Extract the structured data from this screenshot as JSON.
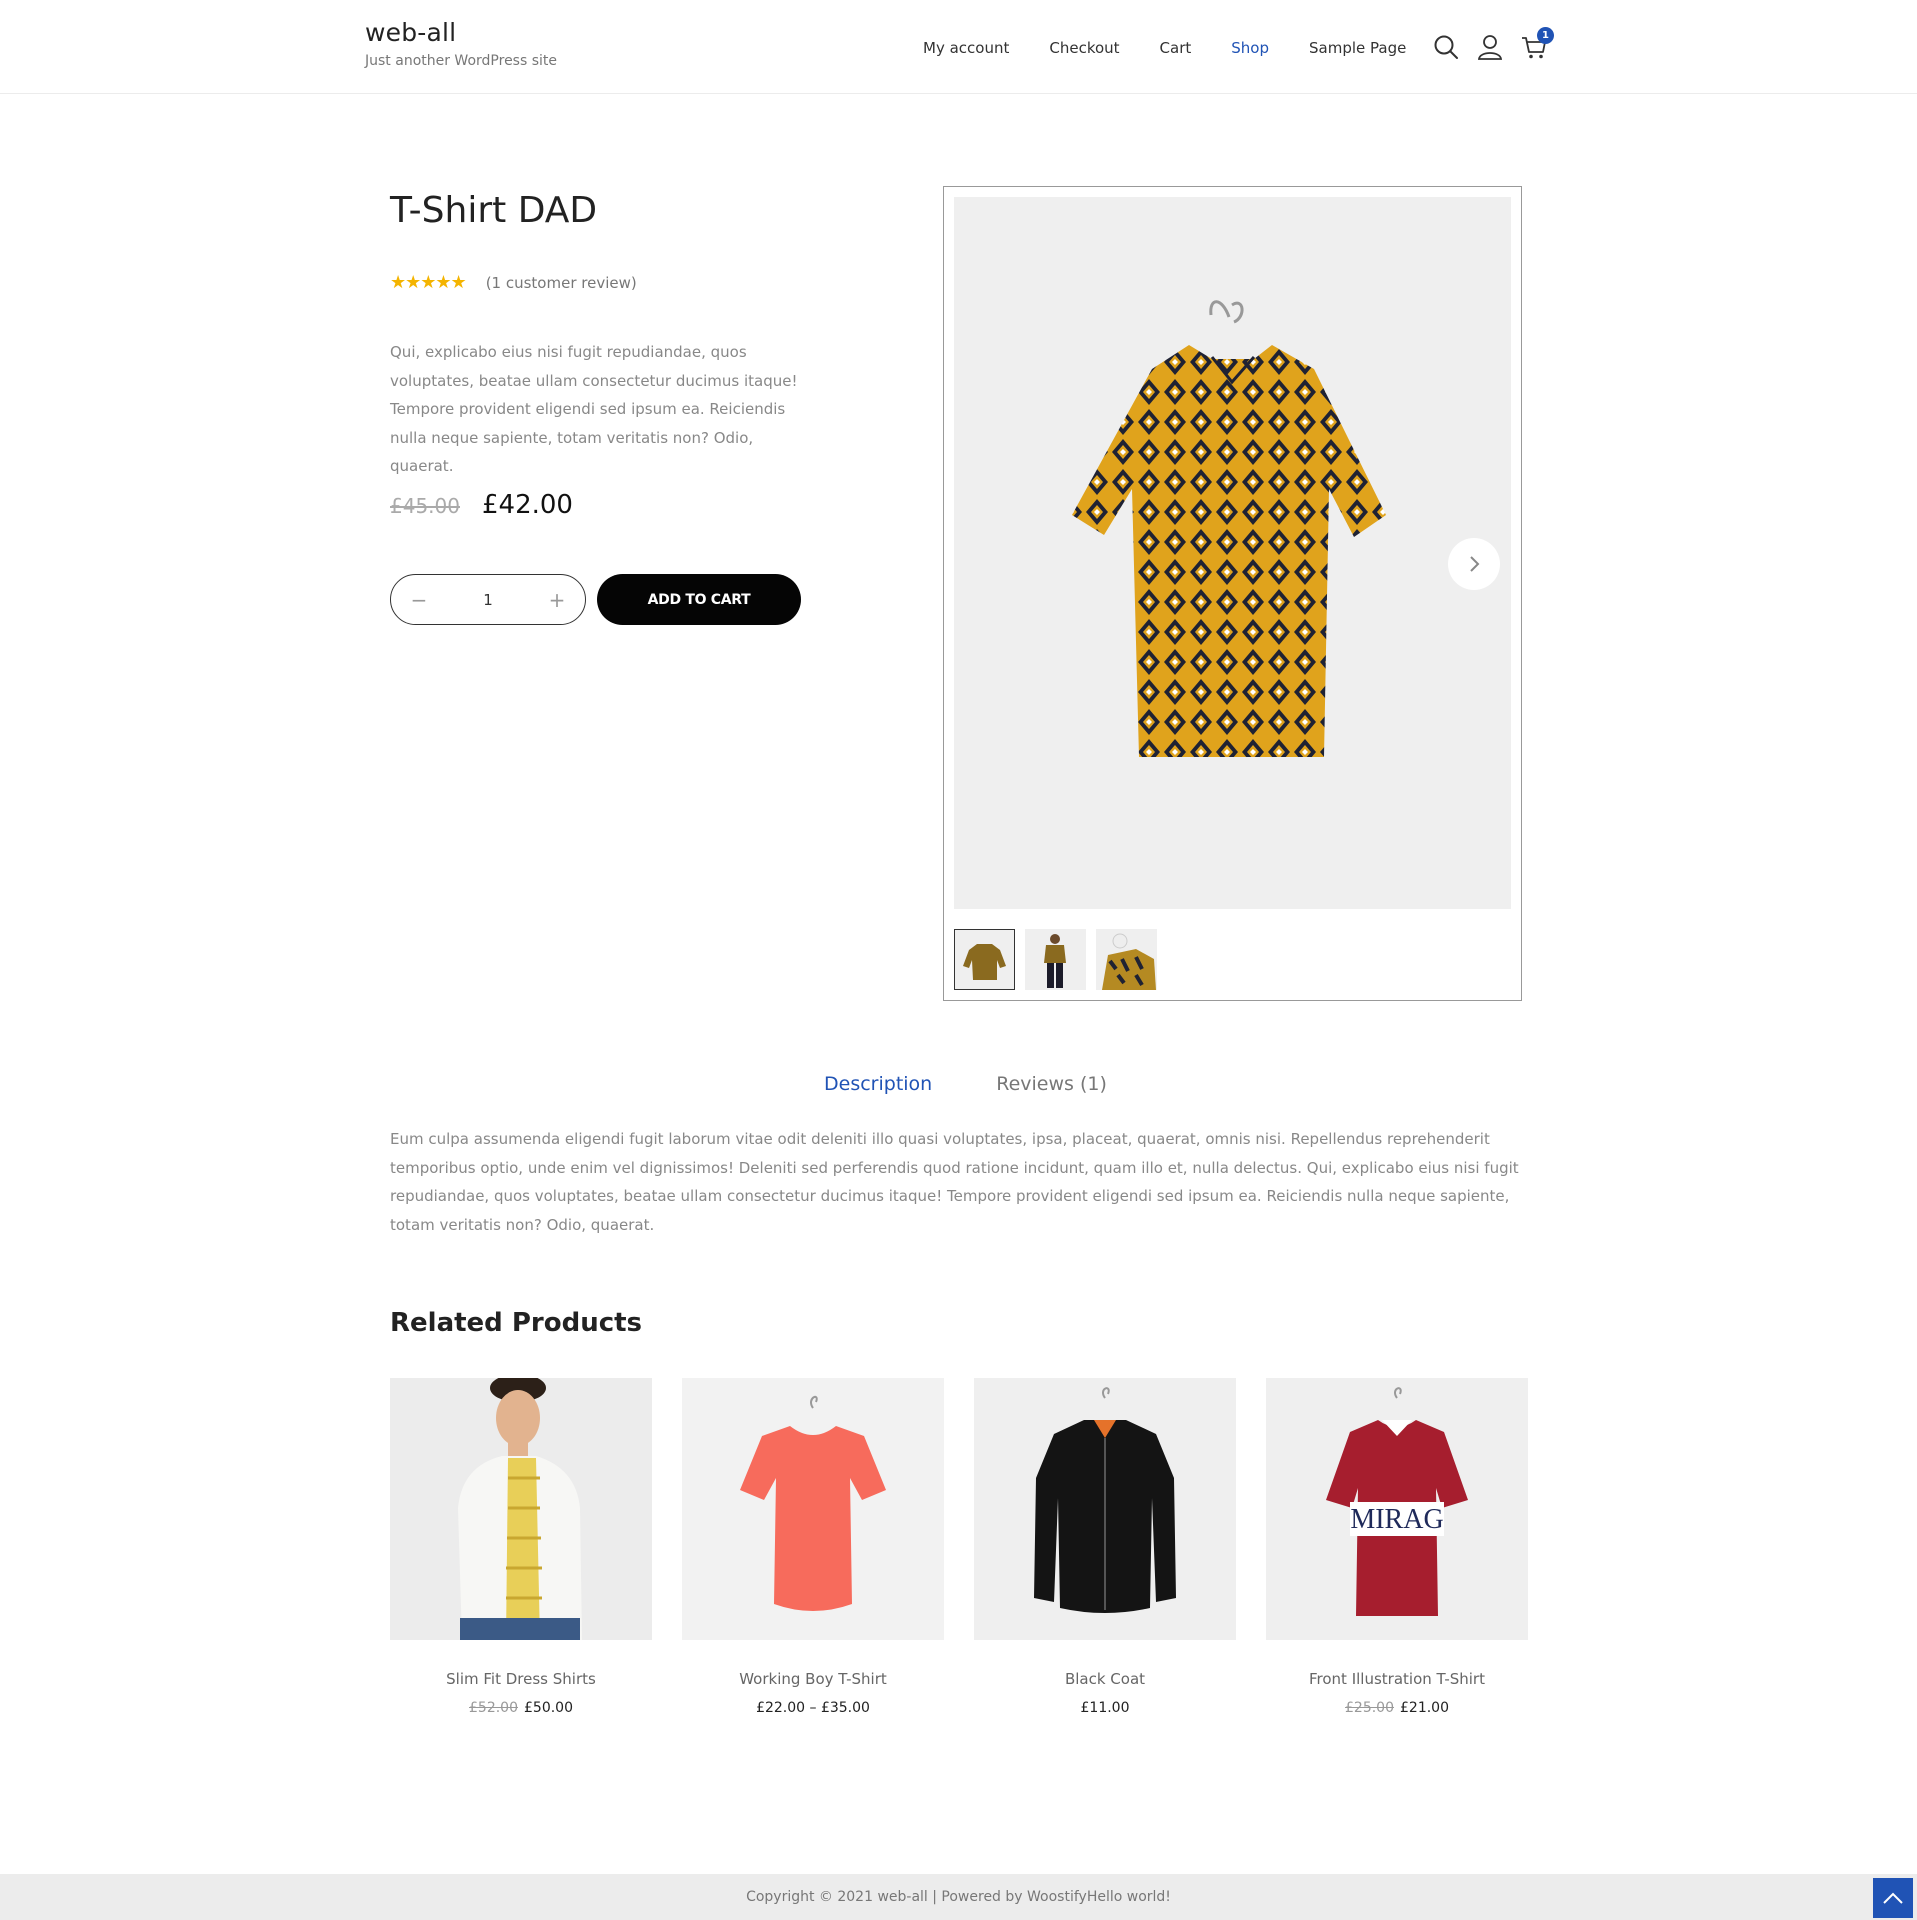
{
  "colors": {
    "accent": "#2053b5",
    "star": "#f4b400",
    "button": "#050505"
  },
  "header": {
    "site_title": "web-all",
    "tagline": "Just another WordPress site",
    "nav": [
      {
        "label": "My account"
      },
      {
        "label": "Checkout"
      },
      {
        "label": "Cart"
      },
      {
        "label": "Shop"
      },
      {
        "label": "Sample Page"
      }
    ],
    "cart_count": "1",
    "icons": [
      "search-icon",
      "user-icon",
      "cart-icon"
    ]
  },
  "product": {
    "title": "T-Shirt DAD",
    "rating": 5,
    "stars": "★★★★★",
    "review_link": "(1 customer review)",
    "short_description": "Qui, explicabo eius nisi fugit repudiandae, quos voluptates, beatae ullam consectetur ducimus itaque! Tempore provident eligendi sed ipsum ea. Reiciendis nulla neque sapiente, totam veritatis non? Odio, quaerat.",
    "old_price": "£45.00",
    "price": "£42.00",
    "quantity": "1",
    "qty_minus": "−",
    "qty_plus": "+",
    "add_to_cart": "ADD TO CART"
  },
  "tabs": [
    {
      "label": "Description"
    },
    {
      "label": "Reviews (1)"
    }
  ],
  "description": "Eum culpa assumenda eligendi fugit laborum vitae odit deleniti illo quasi voluptates, ipsa, placeat, quaerat, omnis nisi. Repellendus reprehenderit temporibus optio, unde enim vel dignissimos! Deleniti sed perferendis quod ratione incidunt, quam illo et, nulla delectus. Qui, explicabo eius nisi fugit repudiandae, quos voluptates, beatae ullam consectetur ducimus itaque! Tempore provident eligendi sed ipsum ea. Reiciendis nulla neque sapiente, totam veritatis non? Odio, quaerat.",
  "related": {
    "title": "Related Products",
    "items": [
      {
        "name": "Slim Fit Dress Shirts",
        "old_price": "£52.00",
        "price": "£50.00"
      },
      {
        "name": "Working Boy T-Shirt",
        "old_price": "",
        "price": "£22.00 – £35.00"
      },
      {
        "name": "Black Coat",
        "old_price": "",
        "price": "£11.00"
      },
      {
        "name": "Front Illustration T-Shirt",
        "old_price": "£25.00",
        "price": "£21.00",
        "print": "MIRAG"
      }
    ]
  },
  "footer": {
    "copyright": "Copyright © 2021 web-all | Powered by WoostifyHello world!"
  }
}
